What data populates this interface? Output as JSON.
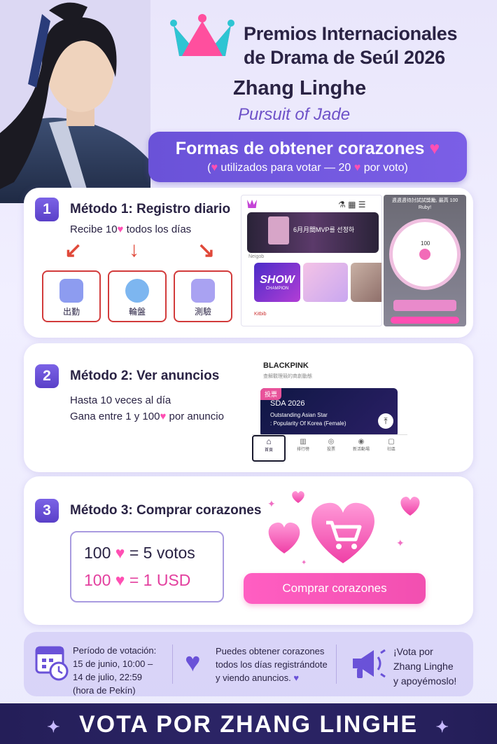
{
  "header": {
    "title_line1": "Premios Internacionales",
    "title_line2": "de Drama de Seúl 2026",
    "actor": "Zhang Linghe",
    "drama": "Pursuit of Jade"
  },
  "ways": {
    "title": "Formas de obtener corazones",
    "subtitle_open": "(",
    "subtitle_mid": "utilizados para votar — 20",
    "subtitle_end": "por voto)"
  },
  "method1": {
    "number": "1",
    "title": "Método 1: Registro diario",
    "text_prefix": "Recibe 10",
    "text_suffix": "todos los días",
    "tiles": [
      {
        "label": "出勤",
        "icon": "calendar-icon"
      },
      {
        "label": "輪盤",
        "icon": "roulette-icon"
      },
      {
        "label": "測驗",
        "icon": "quiz-icon"
      }
    ],
    "screen": {
      "banner_text": "6月月間MVP를 선정하",
      "brand_small": "Neigob",
      "show_label": "SHOW",
      "show_sub": "CHAMPION",
      "footer_small": "Kitbib",
      "wheel_caption": "週週週待討試試獎勵, 最高 100 Ruby!",
      "wheel_value": "100"
    }
  },
  "method2": {
    "number": "2",
    "title": "Método 2: Ver anuncios",
    "line1": "Hasta 10 veces al día",
    "line2_prefix": "Gana entre 1 y 100",
    "line2_suffix": "por anuncio",
    "screen": {
      "artist": "BLACKPINK",
      "artist_sub": "查解觀理競的商創動態",
      "badge": "投票",
      "event": "SDA 2026",
      "category_line1": "Outstanding Asian Star",
      "category_line2": ": Popularity Of Korea (Female)",
      "tabs": [
        "首頁",
        "排行榜",
        "投票",
        "新活動場",
        "社區"
      ]
    }
  },
  "method3": {
    "number": "3",
    "title": "Método 3: Comprar corazones",
    "price1_amount": "100",
    "price1_value": "= 5 votos",
    "price2_amount": "100",
    "price2_value": "= 1 USD",
    "buy_button": "Comprar corazones"
  },
  "info": {
    "period": [
      "Período de votación:",
      "15 de junio, 10:00 –",
      "14 de julio, 22:59",
      "(hora de Pekín)"
    ],
    "earn": [
      "Puedes obtener corazones",
      "todos los días registrándote",
      "y viendo anuncios."
    ],
    "cta": [
      "¡Vota por",
      "Zhang Linghe",
      "y apoyémoslo!"
    ]
  },
  "footer": {
    "text": "VOTA POR ZHANG LINGHE"
  },
  "colors": {
    "accent": "#6a52d8",
    "pink": "#ff4fb3",
    "dark": "#2a2344",
    "footer_bg": "#241e58"
  }
}
